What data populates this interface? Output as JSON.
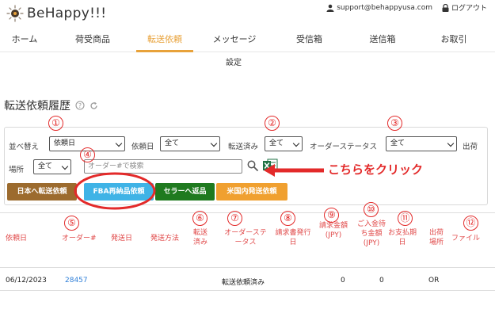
{
  "brand": {
    "name": "BeHappy!!!"
  },
  "header": {
    "email": "support@behappyusa.com",
    "logout": "ログアウト"
  },
  "nav": {
    "items": [
      {
        "label": "ホーム"
      },
      {
        "label": "荷受商品"
      },
      {
        "label": "転送依頼",
        "active": true
      },
      {
        "label": "メッセージ"
      },
      {
        "label": "受信箱"
      },
      {
        "label": "送信箱"
      },
      {
        "label": "お取引"
      }
    ],
    "subnav": "設定"
  },
  "page": {
    "title": "転送依頼履歴"
  },
  "filters": {
    "sort_label": "並べ替え",
    "sort_value": "依頼日",
    "date_label": "依頼日",
    "date_value": "全て",
    "transferred_label": "転送済み",
    "transferred_value": "全て",
    "order_status_label": "オーダーステータス",
    "order_status_value": "全て",
    "ship_label": "出荷",
    "place_label": "場所",
    "place_value": "全て",
    "search_placeholder": "オーダー#で検索"
  },
  "buttons": {
    "japan": "日本へ転送依頼",
    "fba": "FBA再納品依頼",
    "seller": "セラーへ返品",
    "us": "米国内発送依頼"
  },
  "callout": "こちらをクリック",
  "annotations": [
    "①",
    "②",
    "③",
    "④",
    "⑤",
    "⑥",
    "⑦",
    "⑧",
    "⑨",
    "⑩",
    "⑪",
    "⑫"
  ],
  "table": {
    "headers": {
      "request_date": "依頼日",
      "order_no": "オーダー#",
      "ship_date": "発送日",
      "ship_method": "発送方法",
      "transferred": "転送済み",
      "order_status": "オーダーステータス",
      "invoice_date": "請求書発行日",
      "invoice_amount": "請求金額(JPY)",
      "pending_amount": "ご入金待ち金額(JPY)",
      "due_date": "お支払期日",
      "ship_place": "出荷場所",
      "file": "ファイル"
    },
    "rows": [
      {
        "request_date": "06/12/2023",
        "order_no": "28457",
        "order_status": "転送依頼済み",
        "invoice_amount": "0",
        "pending_amount": "0",
        "ship_place": "OR"
      }
    ]
  },
  "colors": {
    "accent": "#e8a23a",
    "annotation_red": "#e32a2a",
    "btn_japan": "#9c6b2e",
    "btn_fba": "#3fb3e6",
    "btn_seller": "#1f7a1f",
    "btn_us": "#f0a030",
    "link_blue": "#2f7fd8",
    "excel_green": "#1f7244"
  }
}
